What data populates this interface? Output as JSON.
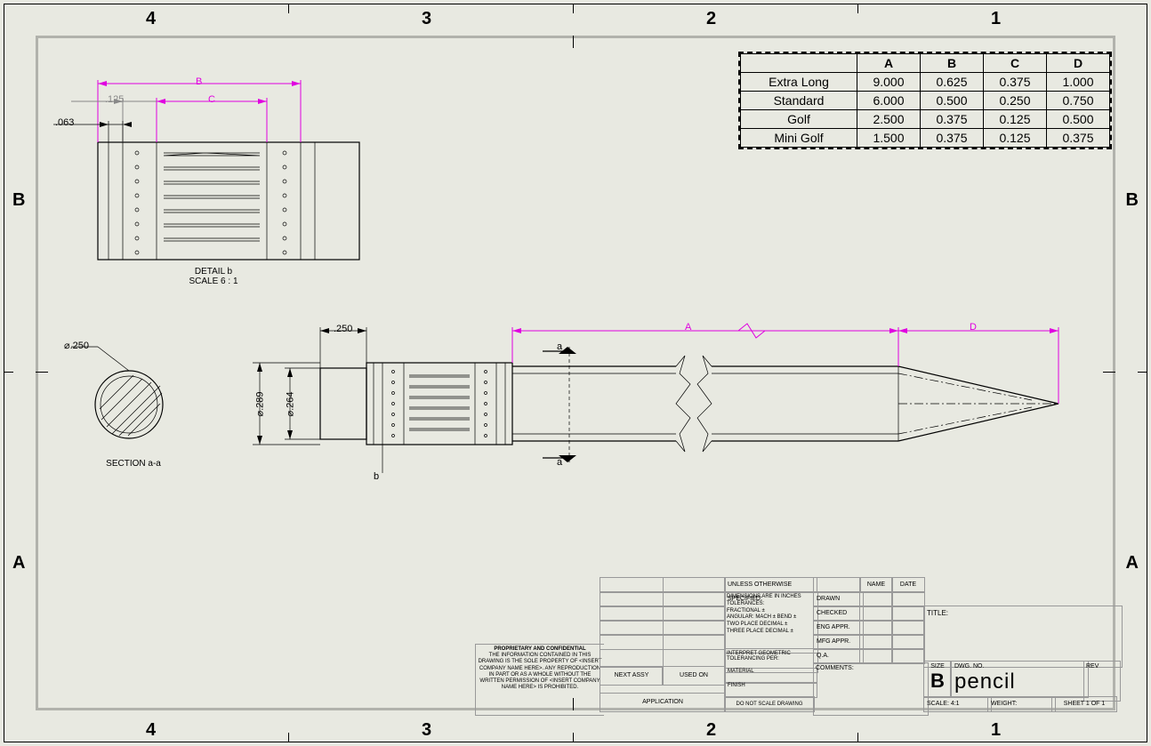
{
  "zones_top": [
    "4",
    "3",
    "2",
    "1"
  ],
  "zones_side": [
    "B",
    "A"
  ],
  "design_table": {
    "headers": [
      "",
      "A",
      "B",
      "C",
      "D"
    ],
    "rows": [
      {
        "name": "Extra Long",
        "A": "9.000",
        "B": "0.625",
        "C": "0.375",
        "D": "1.000"
      },
      {
        "name": "Standard",
        "A": "6.000",
        "B": "0.500",
        "C": "0.250",
        "D": "0.750"
      },
      {
        "name": "Golf",
        "A": "2.500",
        "B": "0.375",
        "C": "0.125",
        "D": "0.500"
      },
      {
        "name": "Mini Golf",
        "A": "1.500",
        "B": "0.375",
        "C": "0.125",
        "D": "0.375"
      }
    ]
  },
  "detail": {
    "label": "DETAIL b",
    "scale": "SCALE 6 : 1",
    "dimB": "B",
    "dimC": "C",
    "dim125": ".125",
    "dim063": ".063"
  },
  "section": {
    "label": "SECTION a-a",
    "dia": "⌀.250"
  },
  "main": {
    "dim250": ".250",
    "dia289": "⌀.289",
    "dia264": "⌀.264",
    "dimA": "A",
    "dimD": "D",
    "cut": "a",
    "detmark": "b"
  },
  "titleblock": {
    "proprietary_heading": "PROPRIETARY AND CONFIDENTIAL",
    "proprietary_body": "THE INFORMATION CONTAINED IN THIS DRAWING IS THE SOLE PROPERTY OF <INSERT COMPANY NAME HERE>. ANY REPRODUCTION IN PART OR AS A WHOLE WITHOUT THE WRITTEN PERMISSION OF <INSERT COMPANY NAME HERE> IS PROHIBITED.",
    "unless": "UNLESS OTHERWISE SPECIFIED:",
    "tol": "DIMENSIONS ARE IN INCHES\nTOLERANCES:\nFRACTIONAL ±\nANGULAR: MACH ±   BEND ±\nTWO PLACE DECIMAL   ±\nTHREE PLACE DECIMAL ±",
    "interp": "INTERPRET GEOMETRIC\nTOLERANCING PER:",
    "material": "MATERIAL",
    "finish": "FINISH",
    "dns": "DO NOT SCALE DRAWING",
    "nextassy": "NEXT ASSY",
    "usedon": "USED ON",
    "application": "APPLICATION",
    "name": "NAME",
    "date": "DATE",
    "drawn": "DRAWN",
    "checked": "CHECKED",
    "engappr": "ENG APPR.",
    "mfgappr": "MFG APPR.",
    "qa": "Q.A.",
    "comments": "COMMENTS:",
    "title_lbl": "TITLE:",
    "size_lbl": "SIZE",
    "size": "B",
    "dwgno_lbl": "DWG. NO.",
    "dwgno": "pencil",
    "rev_lbl": "REV",
    "scale_lbl": "SCALE: 4:1",
    "weight": "WEIGHT:",
    "sheet": "SHEET 1 OF 1"
  }
}
